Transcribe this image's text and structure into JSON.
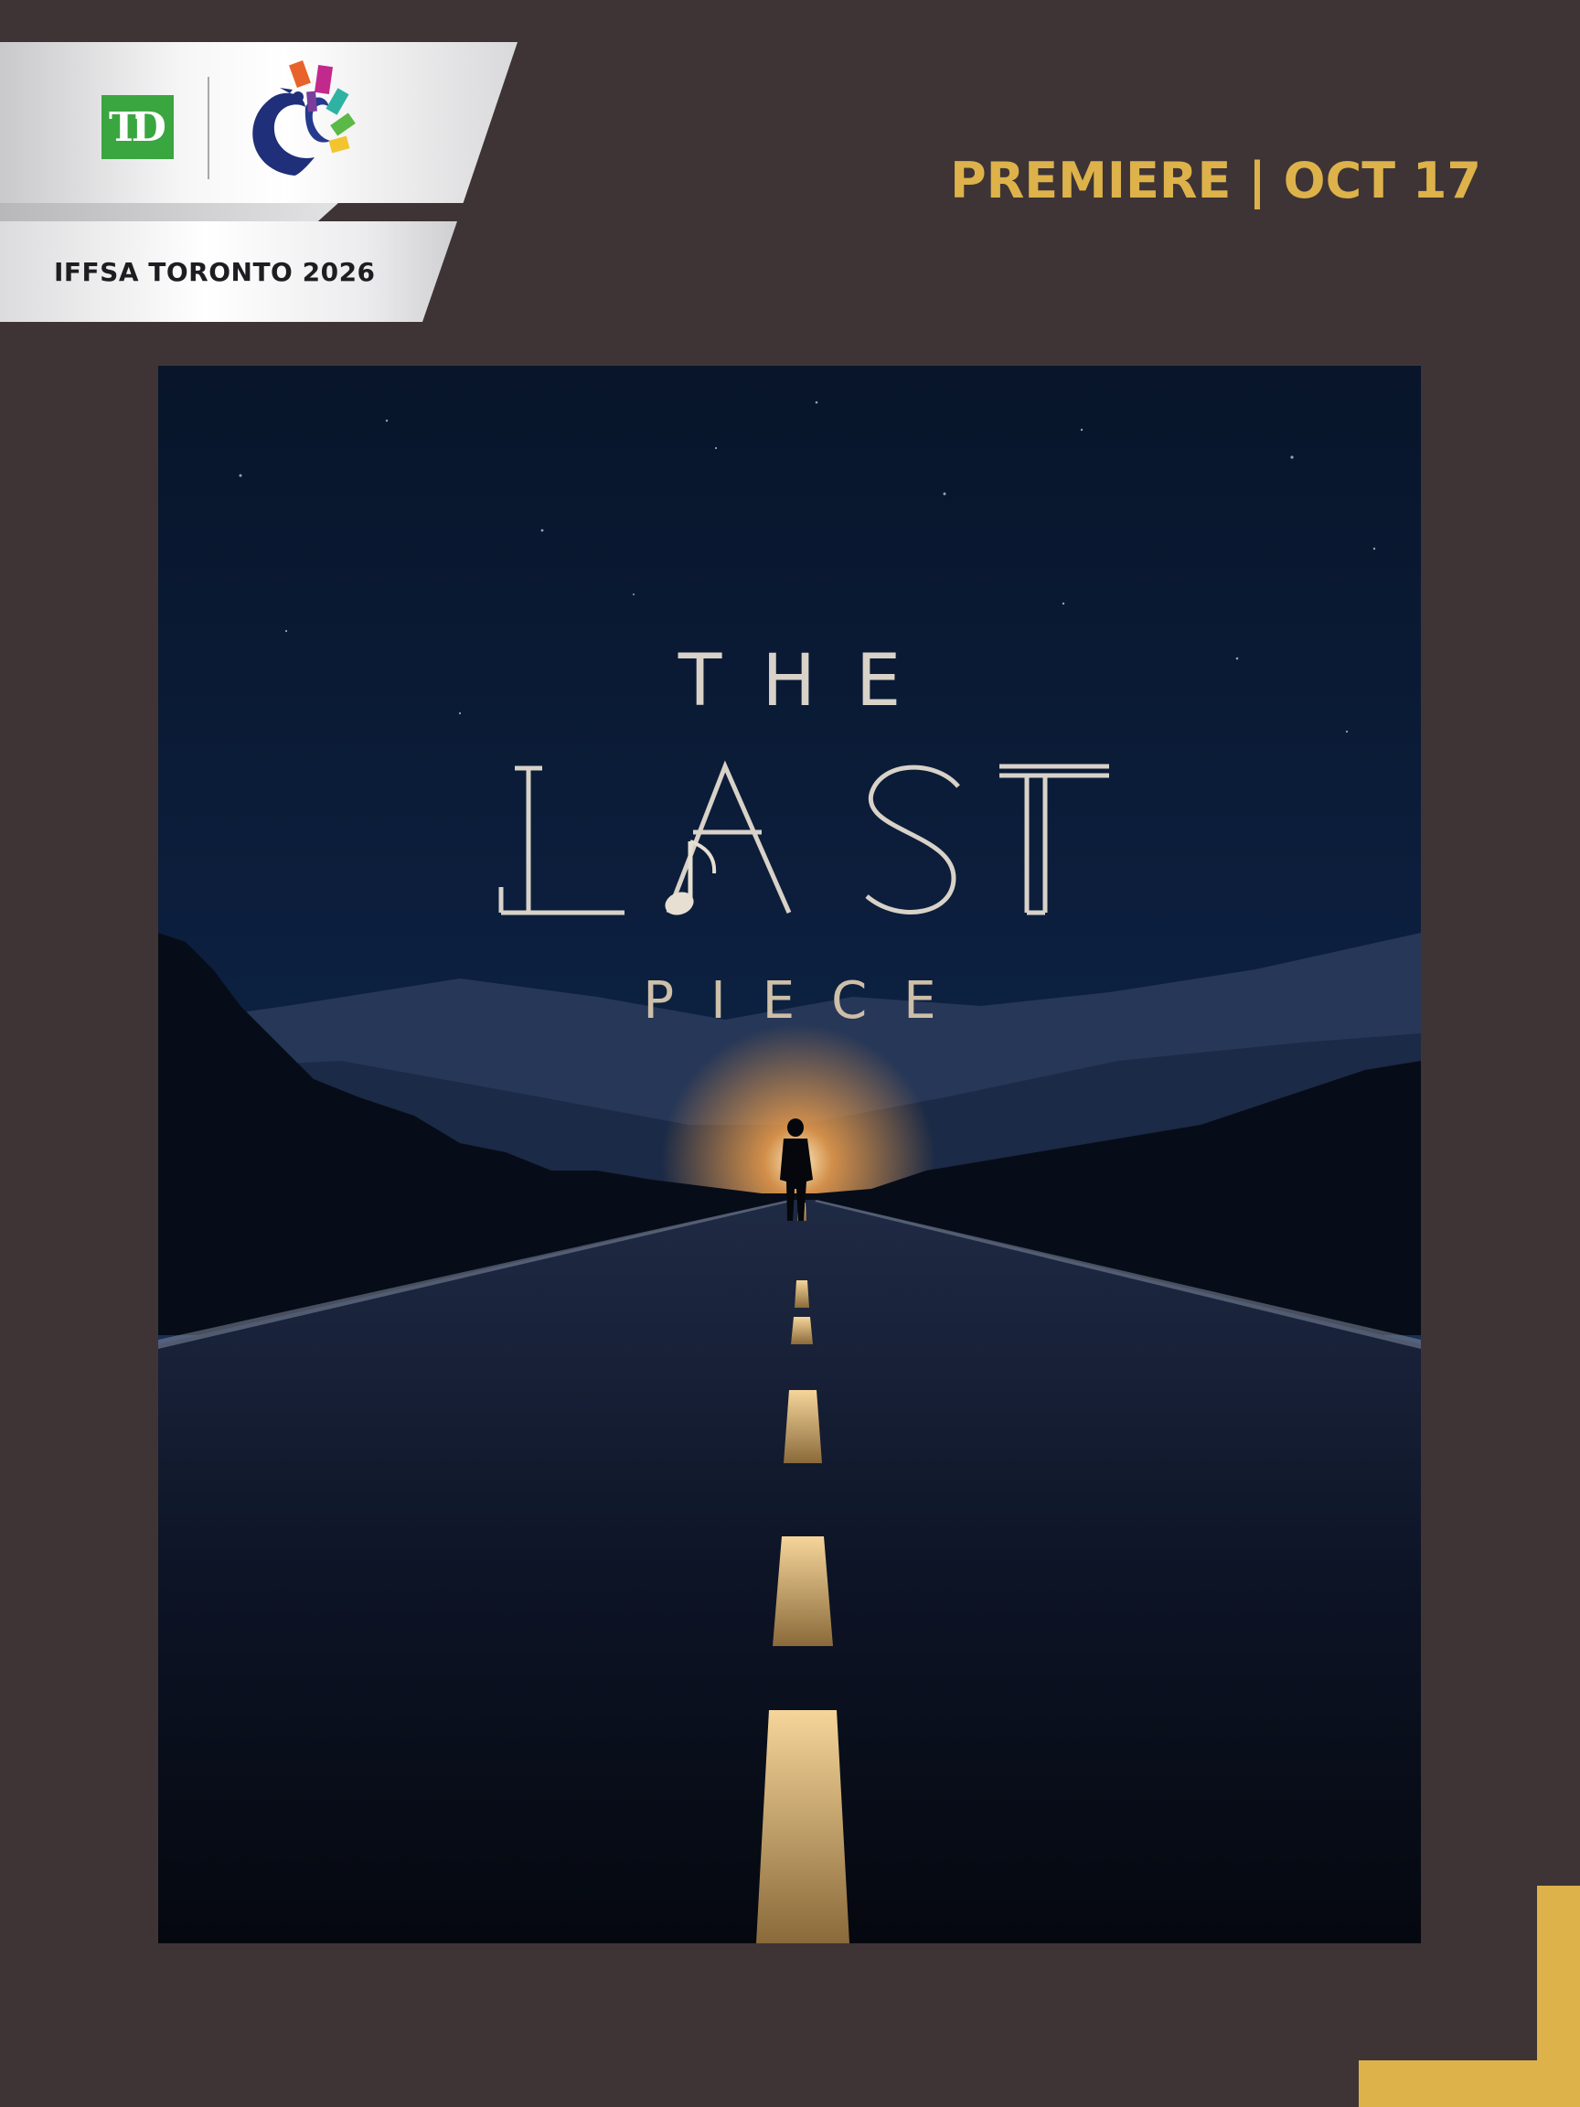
{
  "header": {
    "sponsor_logo_text": "TD",
    "festival_logo_icon": "phoenix-film-reel-icon",
    "festival_name": "IFFSA TORONTO 2026",
    "premiere_text": "PREMIERE | OCT 17"
  },
  "poster": {
    "title_top": "THE",
    "title_main": "LAST",
    "title_bottom": "PIECE",
    "music_note_icon": "music-note-icon",
    "scene": "man walking down a night road toward a glowing horizon"
  },
  "colors": {
    "background": "#3e3436",
    "accent_gold": "#ddb24a",
    "td_green": "#3aa63f",
    "poster_sky": "#0b1a33"
  }
}
